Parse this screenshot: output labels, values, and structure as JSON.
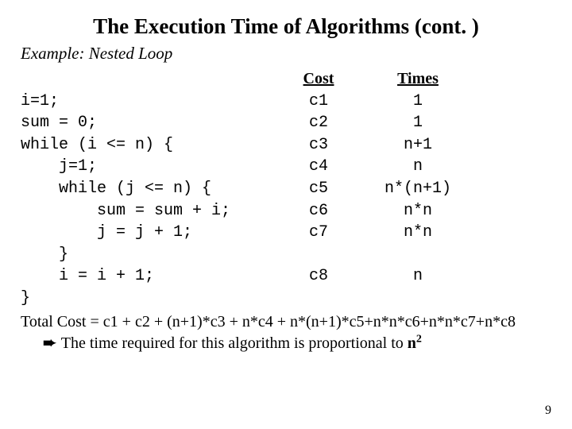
{
  "title": "The Execution Time of Algorithms (cont. )",
  "subtitle": "Example: Nested Loop",
  "headers": {
    "cost": "Cost",
    "times": "Times"
  },
  "rows": [
    {
      "code": "i=1;",
      "cost": "c1",
      "times": "1"
    },
    {
      "code": "sum = 0;",
      "cost": "c2",
      "times": "1"
    },
    {
      "code": "while (i <= n) {",
      "cost": "c3",
      "times": "n+1"
    },
    {
      "code": "    j=1;",
      "cost": "c4",
      "times": "n"
    },
    {
      "code": "    while (j <= n) {",
      "cost": "c5",
      "times": "n*(n+1)"
    },
    {
      "code": "        sum = sum + i;",
      "cost": "c6",
      "times": "n*n"
    },
    {
      "code": "        j = j + 1;",
      "cost": "c7",
      "times": "n*n"
    },
    {
      "code": "    }",
      "cost": "",
      "times": ""
    },
    {
      "code": "    i = i + 1;",
      "cost": "c8",
      "times": "n"
    },
    {
      "code": "}",
      "cost": "",
      "times": ""
    }
  ],
  "total_prefix": "Total Cost  =  ",
  "total_expr": "c1 + c2 + (n+1)*c3 + n*c4 + n*(n+1)*c5+n*n*c6+n*n*c7+n*c8",
  "arrow": "➨",
  "conclusion_pre": "The time required for this algorithm is proportional to ",
  "conclusion_n": "n",
  "conclusion_exp": "2",
  "page_number": "9"
}
